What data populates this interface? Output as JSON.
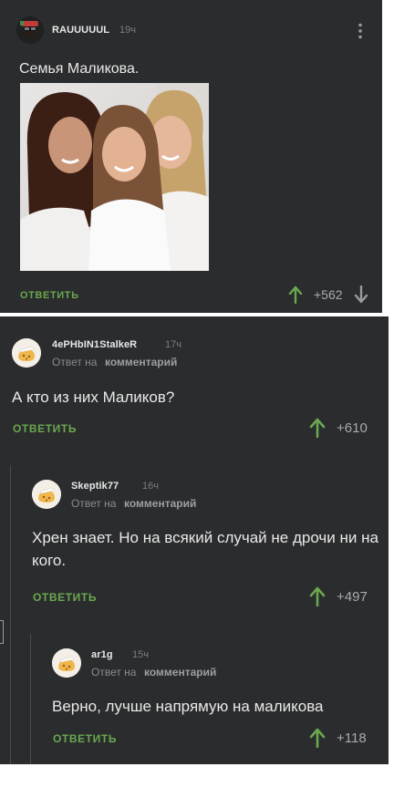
{
  "post": {
    "username": "RAUUUUUL",
    "time": "19ч",
    "text": "Семья Маликова.",
    "reply_label": "ОТВЕТИТЬ",
    "score": "+562"
  },
  "comments": [
    {
      "username": "4ePHbIN1StalkeR",
      "time": "17ч",
      "reply_to_prefix": "Ответ на",
      "reply_to_target": "комментарий",
      "text": "А кто из них Маликов?",
      "reply_label": "ОТВЕТИТЬ",
      "score": "+610"
    },
    {
      "username": "Skeptik77",
      "time": "16ч",
      "reply_to_prefix": "Ответ на",
      "reply_to_target": "комментарий",
      "text": "Хрен знает. Но на всякий случай не дрочи ни на кого.",
      "reply_label": "ОТВЕТИТЬ",
      "score": "+497"
    },
    {
      "username": "ar1g",
      "time": "15ч",
      "reply_to_prefix": "Ответ на",
      "reply_to_target": "комментарий",
      "text": "Верно, лучше напрямую на маликова",
      "reply_label": "ОТВЕТИТЬ",
      "score": "+118"
    }
  ],
  "colors": {
    "background": "#2b2c2e",
    "accent_green": "#6aa84f",
    "text": "#e9e9e9",
    "muted": "#8a8b8e"
  },
  "icons": [
    "more-vertical-icon",
    "upvote-arrow-icon",
    "downvote-arrow-icon",
    "cookie-avatar-icon"
  ]
}
